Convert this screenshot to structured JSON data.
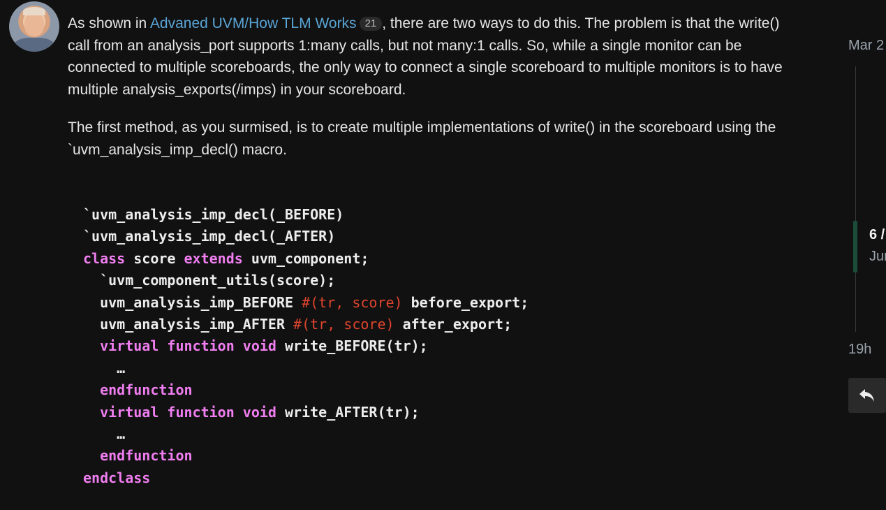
{
  "post": {
    "p1_before_link": "As shown in ",
    "link_text": "Advaned UVM/How TLM Works",
    "link_badge": "21",
    "p1_after_link": ", there are two ways to do this. The problem is that the write() call from an analysis_port supports 1:many calls, but not many:1 calls. So, while a single monitor can be connected to multiple scoreboards, the only way to connect a single scoreboard to multiple monitors is to have multiple analysis_exports(/imps) in your scoreboard.",
    "p2": "The first method, as you surmised, is to create multiple implementations of write() in the scoreboard using the `uvm_analysis_imp_decl() macro."
  },
  "code": {
    "l1": "`uvm_analysis_imp_decl(_BEFORE)",
    "l2": "`uvm_analysis_imp_decl(_AFTER)",
    "l3_kw1": "class",
    "l3_a": " score ",
    "l3_kw2": "extends",
    "l3_b": " uvm_component;",
    "l4": "  `uvm_component_utils(score);",
    "l5_a": "  uvm_analysis_imp_BEFORE ",
    "l5_str": "#(tr, score)",
    "l5_b": " before_export;",
    "l6_a": "  uvm_analysis_imp_AFTER ",
    "l6_str": "#(tr, score)",
    "l6_b": " after_export;",
    "l7_kw": "  virtual function void",
    "l7_b": " write_BEFORE(tr);",
    "l8": "    …",
    "l9_kw": "  endfunction",
    "l10_kw": "  virtual function void",
    "l10_b": " write_AFTER(tr);",
    "l11": "    …",
    "l12_kw": "  endfunction",
    "l13_kw": "endclass"
  },
  "timeline": {
    "top_date": "Mar 2",
    "count": "6 /",
    "current_date": "Jur",
    "bottom_label": "19h"
  },
  "icons": {
    "reply": "reply-arrow-icon",
    "avatar": "user-avatar"
  },
  "colors": {
    "link": "#5aa5d6",
    "keyword": "#f07ef0",
    "string": "#e0452e",
    "background": "#111111"
  }
}
